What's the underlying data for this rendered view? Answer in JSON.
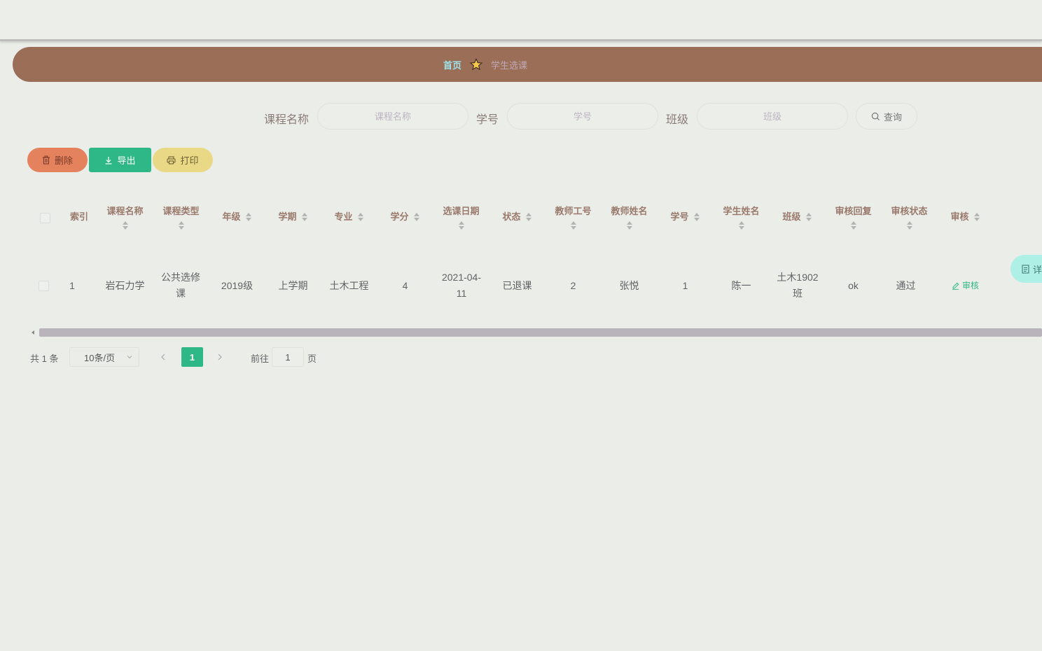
{
  "breadcrumb": {
    "home": "首页",
    "current": "学生选课"
  },
  "search": {
    "course_label": "课程名称",
    "course_placeholder": "课程名称",
    "student_no_label": "学号",
    "student_no_placeholder": "学号",
    "class_label": "班级",
    "class_placeholder": "班级",
    "query_button": "查询"
  },
  "toolbar": {
    "delete": "删除",
    "export": "导出",
    "print": "打印"
  },
  "table": {
    "columns": [
      "索引",
      "课程名称",
      "课程类型",
      "年级",
      "学期",
      "专业",
      "学分",
      "选课日期",
      "状态",
      "教师工号",
      "教师姓名",
      "学号",
      "学生姓名",
      "班级",
      "审核回复",
      "审核状态",
      "审核"
    ],
    "rows": [
      {
        "index": "1",
        "course_name": "岩石力学",
        "course_type": "公共选修课",
        "grade": "2019级",
        "semester": "上学期",
        "major": "土木工程",
        "credit": "4",
        "date": "2021-04-11",
        "status": "已退课",
        "teacher_no": "2",
        "teacher_name": "张悦",
        "student_no": "1",
        "student_name": "陈一",
        "class": "土木1902班",
        "reply": "ok",
        "audit_status": "通过",
        "audit_action": "审核",
        "detail_action": "详"
      }
    ]
  },
  "pagination": {
    "total": "共 1 条",
    "page_size": "10条/页",
    "current_page": "1",
    "goto_prefix": "前往",
    "goto_value": "1",
    "goto_suffix": "页"
  },
  "colors": {
    "accent": "#2fb887",
    "breadcrumb_bg": "#9b6e58",
    "delete": "#e3825c",
    "print": "#e9d986",
    "header_text": "#9a7a6c"
  }
}
